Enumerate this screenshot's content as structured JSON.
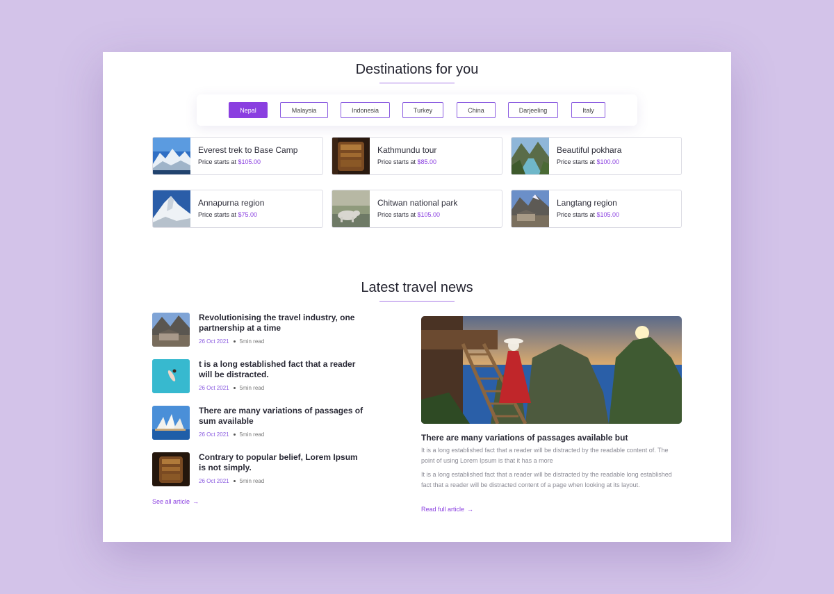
{
  "destinations": {
    "title": "Destinations for you",
    "tabs": [
      {
        "label": "Nepal",
        "active": true
      },
      {
        "label": "Malaysia",
        "active": false
      },
      {
        "label": "Indonesia",
        "active": false
      },
      {
        "label": "Turkey",
        "active": false
      },
      {
        "label": "China",
        "active": false
      },
      {
        "label": "Darjeeling",
        "active": false
      },
      {
        "label": "Italy",
        "active": false
      }
    ],
    "price_prefix": "Price starts at",
    "items": [
      {
        "name": "Everest trek to Base Camp",
        "price": "$105.00",
        "image": "snowy-mountains"
      },
      {
        "name": "Kathmundu tour",
        "price": "$85.00",
        "image": "temple-bell"
      },
      {
        "name": "Beautiful pokhara",
        "price": "$100.00",
        "image": "river-valley"
      },
      {
        "name": "Annapurna region",
        "price": "$75.00",
        "image": "snow-peak"
      },
      {
        "name": "Chitwan national park",
        "price": "$105.00",
        "image": "rhino"
      },
      {
        "name": "Langtang region",
        "price": "$105.00",
        "image": "mountain-village"
      }
    ]
  },
  "news": {
    "title": "Latest travel news",
    "items": [
      {
        "title": "Revolutionising the travel industry, one partnership at a time",
        "date": "26 Oct 2021",
        "read": "5min read",
        "image": "mountain-village"
      },
      {
        "title": "t is a long established fact that a reader will be distracted.",
        "date": "26 Oct 2021",
        "read": "5min read",
        "image": "swimmer-pool"
      },
      {
        "title": "There are many variations of passages of sum available",
        "date": "26 Oct 2021",
        "read": "5min read",
        "image": "opera-house"
      },
      {
        "title": "Contrary to popular belief, Lorem Ipsum is not simply.",
        "date": "26 Oct 2021",
        "read": "5min read",
        "image": "temple-bell"
      }
    ],
    "see_all": "See all article",
    "feature": {
      "title": "There are many variations of passages available but",
      "paragraph1": "It is a long established fact that a reader will be distracted by the readable content of. The point of using Lorem Ipsum is that it has a more",
      "paragraph2": "It is a long established fact that a reader will be distracted by the readable long established fact that a reader will be distracted content of a page when looking at its layout.",
      "read_more": "Read full article",
      "image": "woman-on-cliff-ladder"
    }
  },
  "colors": {
    "accent": "#8a3fe0",
    "background": "#d3c3e9",
    "card": "#ffffff"
  }
}
